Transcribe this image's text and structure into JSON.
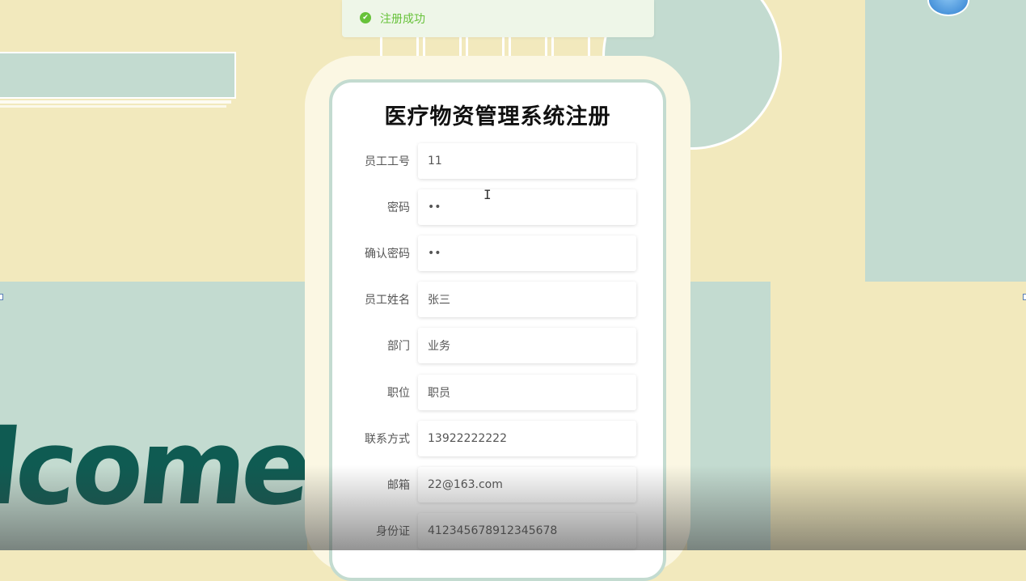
{
  "toast": {
    "message": "注册成功",
    "icon": "check-circle-icon",
    "color": "#67c23a"
  },
  "form": {
    "title": "医疗物资管理系统注册",
    "fields": [
      {
        "label": "员工工号",
        "value": "11"
      },
      {
        "label": "密码",
        "value": "••"
      },
      {
        "label": "确认密码",
        "value": "••"
      },
      {
        "label": "员工姓名",
        "value": "张三"
      },
      {
        "label": "部门",
        "value": "业务"
      },
      {
        "label": "职位",
        "value": "职员"
      },
      {
        "label": "联系方式",
        "value": "13922222222"
      },
      {
        "label": "邮箱",
        "value": "22@163.com"
      },
      {
        "label": "身份证",
        "value": "412345678912345678"
      }
    ]
  },
  "background": {
    "welcome_text": "lcome",
    "accent": "#c3dbd0",
    "base": "#f2e9bd",
    "text_color": "#0f5b52"
  }
}
